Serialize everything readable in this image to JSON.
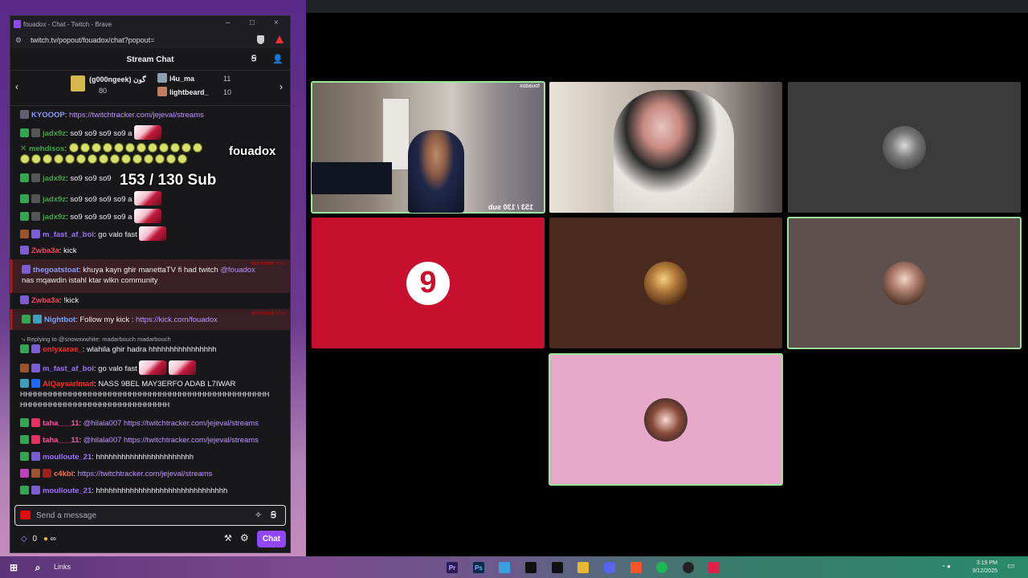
{
  "window": {
    "title": "fouadox - Chat - Twitch - Brave",
    "url": "twitch.tv/popout/fouadox/chat?popout="
  },
  "chat_header": {
    "title": "Stream Chat"
  },
  "leaderboard": {
    "gifter_name": "(g000ngeek) گون",
    "gifter_count": "80",
    "second_name": "l4u_ma",
    "second_count": "11",
    "third_name": "lightbeard_",
    "third_count": "10"
  },
  "messages": [
    {
      "user": "KYOOOP",
      "color": "#8a9bff",
      "text": "",
      "link": "https://twitchtracker.com/jejeval/streams"
    },
    {
      "user": "jadx9z",
      "color": "#3fa34a",
      "text": "so9 so9 so9 so9 a"
    },
    {
      "user": "mehdisos",
      "color": "#3fa34a",
      "text": ""
    },
    {
      "user": "jadx9z",
      "color": "#3fa34a",
      "text": "so9 so9 so9"
    },
    {
      "user": "jadx9z",
      "color": "#3fa34a",
      "text": "so9 so9 so9 so9 a"
    },
    {
      "user": "jadx9z",
      "color": "#3fa34a",
      "text": "so9 so9 so9 so9 a"
    },
    {
      "user": "m_fast_af_boi",
      "color": "#a070ff",
      "text": "go valo fast"
    },
    {
      "user": "Zwba3a",
      "color": "#ff4060",
      "text": "kick"
    },
    {
      "user": "thegoatstoat",
      "color": "#8a9bff",
      "text": "khuya kayn ghir manettaTV fi had twitch",
      "mention": "@fouadox",
      "text2": "nas mqawdin istahl ktar wlkn community",
      "tag": "MENTIONS YOU"
    },
    {
      "user": "Zwba3a",
      "color": "#ff4060",
      "text": "!kick"
    },
    {
      "user": "Nightbot",
      "color": "#6fa8ff",
      "text": "Follow my kick :",
      "link": "https://kick.com/fouadox",
      "tag": "MENTIONS YOU"
    },
    {
      "reply": "Replying to @snowxxwhite: madarbouch madarbouch"
    },
    {
      "user": "onlyxarae_",
      "color": "#ff2a2a",
      "text": "wlahila ghir hadra hhhhhhhhhhhhhhhh"
    },
    {
      "user": "m_fast_af_boi",
      "color": "#a070ff",
      "text": "go valo fast"
    },
    {
      "user": "AlQaysarlmad",
      "color": "#ff2a2a",
      "text": "NASS 9BEL MAY3ERFO ADAB L7IWAR",
      "text2": "HHHHHHHHHHHHHHHHHHHHHHHHHHHHHHHHHHHHHHHHHHHHHHHHHH",
      "text3": "HHHHHHHHHHHHHHHHHHHHHHHHHHHHHH"
    },
    {
      "user": "taha___11",
      "color": "#ff4fa0",
      "mention": "@hilala007",
      "link": "https://twitchtracker.com/jejeval/streams"
    },
    {
      "user": "taha___11",
      "color": "#ff4fa0",
      "mention": "@hilala007",
      "link": "https://twitchtracker.com/jejeval/streams"
    },
    {
      "user": "moulloute_21",
      "color": "#a070ff",
      "text": "hhhhhhhhhhhhhhhhhhhhhhh"
    },
    {
      "user": "c4kbi",
      "color": "#ff7050",
      "link": "https://twitchtracker.com/jejeval/streams"
    },
    {
      "user": "moulloute_21",
      "color": "#a070ff",
      "text": "hhhhhhhhhhhhhhhhhhhhhhhhhhhhhhh"
    }
  ],
  "overlay": {
    "brand": "fouadox",
    "sub_goal": "153 / 130 Sub"
  },
  "input": {
    "placeholder": "Send a message"
  },
  "footer": {
    "points": "0",
    "infinity": "∞",
    "chat_button": "Chat"
  },
  "call": {
    "tile1_name": "fouadox",
    "tile1_sub": "153 / 130 sub",
    "tile_colors": [
      "#3b3b3b",
      "#c8102e",
      "#4a2a1e",
      "#5e504e",
      "#e6a9c9"
    ]
  },
  "taskbar": {
    "search_label": "Links",
    "time": "3:19 PM",
    "date": "9/12/2025",
    "apps": [
      "Pr",
      "Ps"
    ]
  },
  "icons": [
    "twitch-icon",
    "brave-shield-icon",
    "people-icon",
    "gift-icon",
    "chevron-left-icon",
    "chevron-right-icon",
    "emote-icon",
    "settings-icon",
    "windows-start-icon",
    "search-icon"
  ]
}
